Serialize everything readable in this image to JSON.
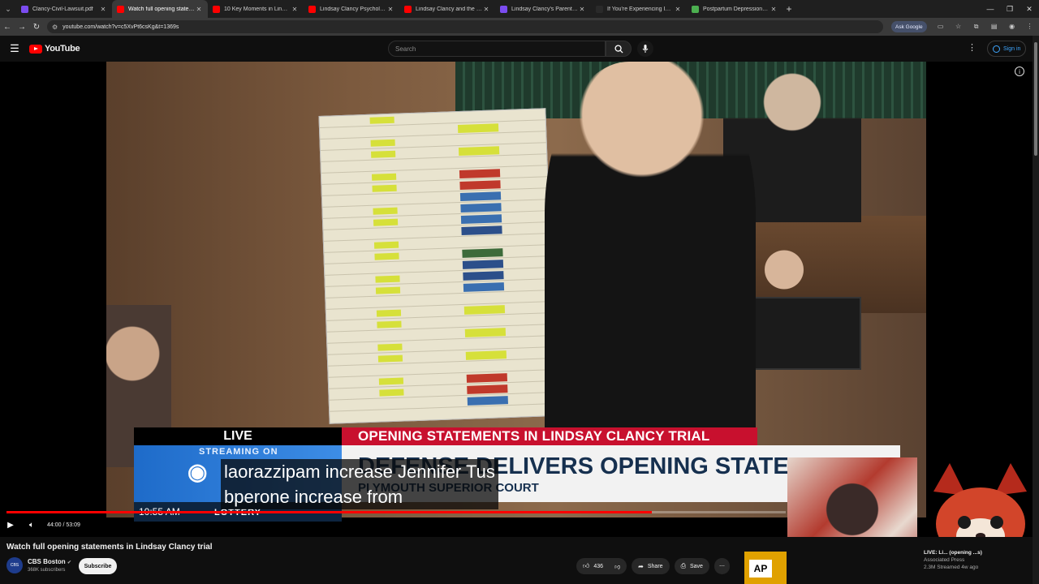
{
  "browser": {
    "tabs": [
      {
        "label": "Clancy-Civil-Lawsuit.pdf",
        "color": "#7b4cf0",
        "active": false
      },
      {
        "label": "Watch full opening statements",
        "color": "#ff0000",
        "active": true
      },
      {
        "label": "10 Key Moments in Lindsay Cla",
        "color": "#ff0000",
        "active": false
      },
      {
        "label": "Lindsay Clancy Psychologist Di",
        "color": "#ff0000",
        "active": false
      },
      {
        "label": "Lindsay Clancy and the Evidenc",
        "color": "#ff0000",
        "active": false
      },
      {
        "label": "Lindsay Clancy's Parents' $1 Mi",
        "color": "#7b4cf0",
        "active": false
      },
      {
        "label": "If You're Experiencing Intrusive",
        "color": "#2a2a2a",
        "active": false
      },
      {
        "label": "Postpartum Depression (PPD):",
        "color": "#4caf50",
        "active": false
      }
    ],
    "url": "youtube.com/watch?v=c5XvPt6csKg&t=1369s",
    "ask_google": "Ask Google"
  },
  "youtube": {
    "logo": "YouTube",
    "search_placeholder": "Search",
    "sign_in": "Sign in"
  },
  "video": {
    "lower_third": {
      "live": "LIVE",
      "headline": "OPENING STATEMENTS IN LINDSAY CLANCY TRIAL",
      "streaming_on": "STREAMING ON",
      "brand": "CBS NEWS BOSTON",
      "subhead": "DEFENSE DELIVERS OPENING STATEMENT",
      "court": "PLYMOUTH SUPERIOR COURT",
      "time": "10:55 AM",
      "lottery": "LOTTERY"
    },
    "caption_line1": "laorazzipam increase Jennifer Tus",
    "caption_line2": "bperone increase from",
    "time_display": "44:00 / 53:09",
    "progress": 0.828
  },
  "meta": {
    "title": "Watch full opening statements in Lindsay Clancy trial",
    "channel": "CBS Boston",
    "channel_initials": "CBS",
    "subscribers": "368K subscribers",
    "subscribe": "Subscribe",
    "likes": "436",
    "share": "Share",
    "save": "Save"
  },
  "recommendation": {
    "badge": "AP",
    "title": "LIVE: Li... (opening ...s)",
    "channel": "Associated Press",
    "stats": "2.3M  Streamed 4w ago"
  }
}
